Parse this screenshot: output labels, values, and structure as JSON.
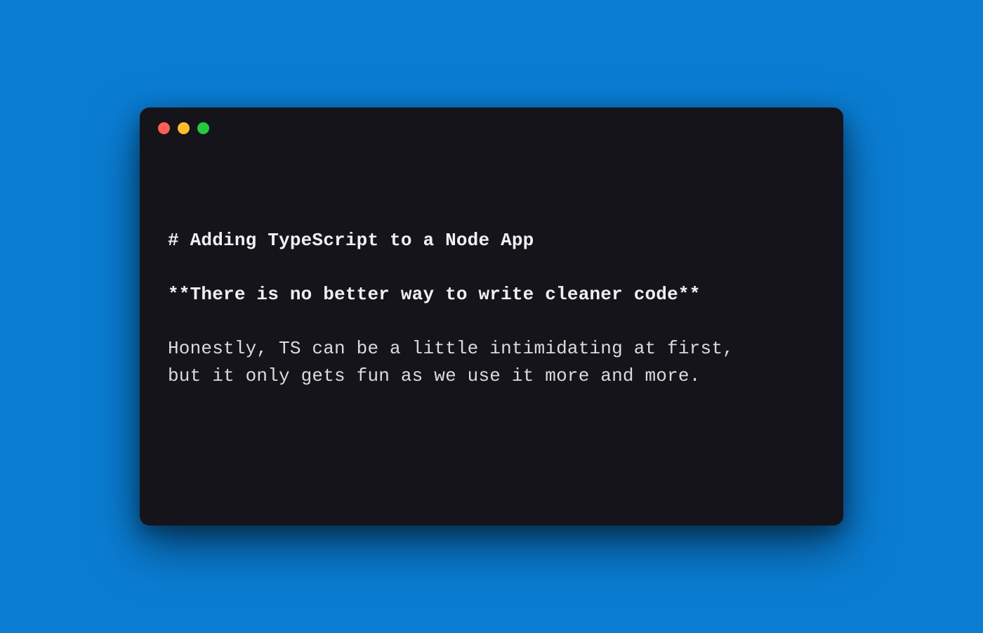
{
  "window": {
    "traffic_lights": {
      "close": "red",
      "minimize": "yellow",
      "maximize": "green"
    }
  },
  "content": {
    "heading": "# Adding TypeScript to a Node App",
    "bold_line": "**There is no better way to write cleaner code**",
    "body_line_1": "Honestly, TS can be a little intimidating at first,",
    "body_line_2": "but it only gets fun as we use it more and more."
  },
  "colors": {
    "background": "#0a7dd3",
    "window_bg": "#14141a",
    "text": "#e6e6e6"
  }
}
